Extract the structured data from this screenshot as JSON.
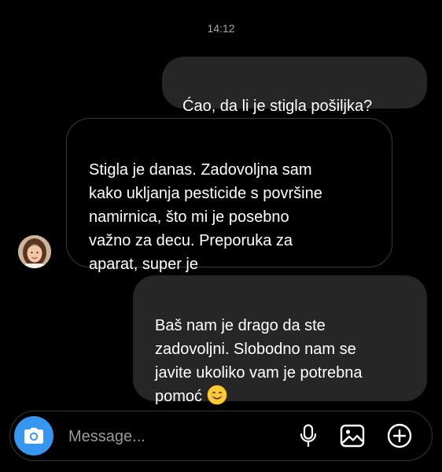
{
  "thread": {
    "timestamp": "14:12",
    "messages": [
      {
        "sender": "me",
        "text": "Ćao, da li je stigla pošiljka?"
      },
      {
        "sender": "contact",
        "text": "Stigla je danas. Zadovoljna sam\nkako ukljanja pesticide s površine\nnamirnica, što mi je posebno\nvažno za decu. Preporuka za\naparat, super je"
      },
      {
        "sender": "me",
        "text": "Baš nam je drago da ste\nzadovoljni. Slobodno nam se\njavite ukoliko vam je potrebna\npomoć",
        "emoji": "smiling-face"
      }
    ]
  },
  "composer": {
    "placeholder": "Message...",
    "icons": [
      "camera-icon",
      "microphone-icon",
      "gallery-icon",
      "add-icon"
    ]
  },
  "colors": {
    "background": "#000000",
    "sent_bubble": "#262626",
    "received_border": "#3a3a3a",
    "camera_button": "#3797f0",
    "timestamp": "#a8a8a8"
  }
}
